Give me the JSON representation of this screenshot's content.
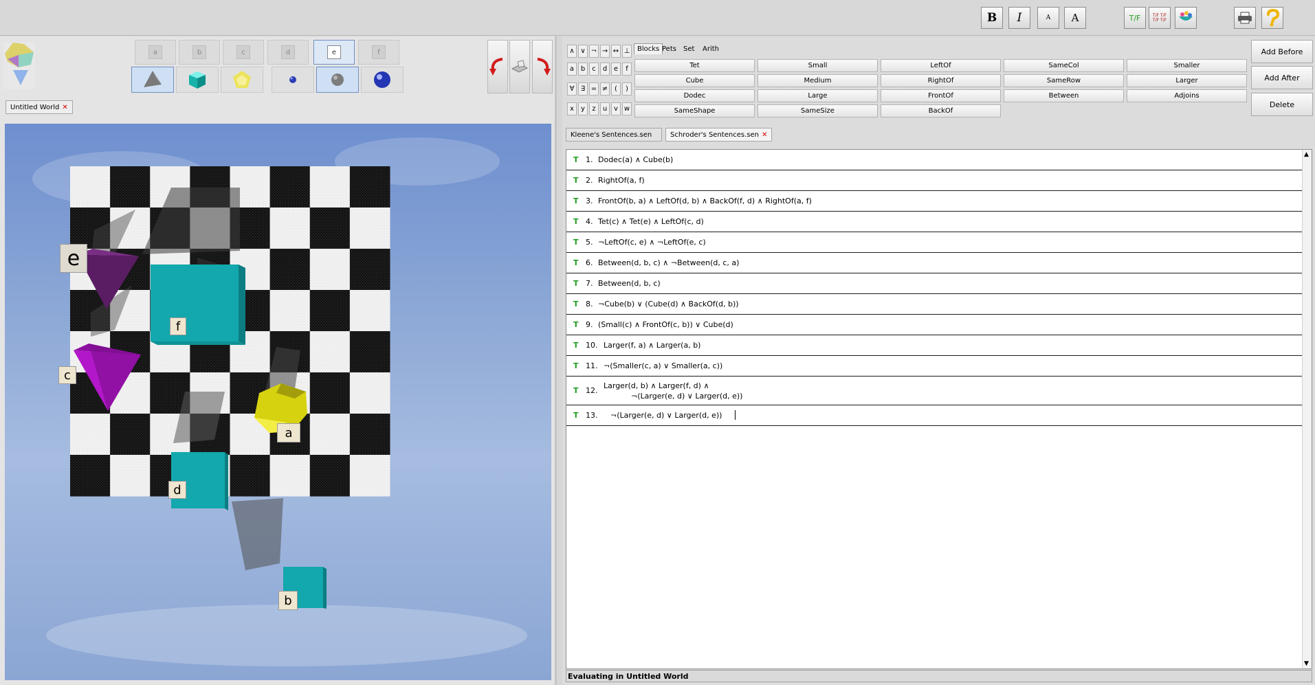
{
  "toolbar": {
    "bold_label": "B",
    "italic_label": "I",
    "font_smaller_label": "A",
    "font_larger_label": "A",
    "tf_label": "T/F",
    "tf_grid_label": "T/F T/F T/F T/F",
    "icons": [
      "bold-icon",
      "italic-icon",
      "font-smaller-icon",
      "font-larger-icon",
      "tf-icon",
      "truth-table-icon",
      "verify-icon",
      "print-icon",
      "help-icon"
    ]
  },
  "world_toolbar": {
    "labels": [
      "a",
      "b",
      "c",
      "d",
      "e",
      "f"
    ],
    "selected_label": "e",
    "shapes": [
      "tetrahedron",
      "cube",
      "dodecahedron"
    ],
    "sizes": [
      "small",
      "medium",
      "large"
    ],
    "selected_size": "medium"
  },
  "world_tab": {
    "label": "Untitled World"
  },
  "world": {
    "blocks": [
      {
        "name": "a",
        "shape": "Dodec",
        "size": "medium",
        "color": "#d7d20f"
      },
      {
        "name": "b",
        "shape": "Cube",
        "size": "small",
        "color": "#12a8ad"
      },
      {
        "name": "c",
        "shape": "Tet",
        "size": "medium",
        "color": "#b217c9"
      },
      {
        "name": "d",
        "shape": "Cube",
        "size": "medium",
        "color": "#12a8ad"
      },
      {
        "name": "e",
        "shape": "Tet",
        "size": "medium",
        "color": "#6b1f76"
      },
      {
        "name": "f",
        "shape": "Cube",
        "size": "large",
        "color": "#12a8ad"
      }
    ]
  },
  "symbols": {
    "row1": [
      "∧",
      "∨",
      "¬",
      "→",
      "↔",
      "⊥"
    ],
    "row2": [
      "a",
      "b",
      "c",
      "d",
      "e",
      "f"
    ],
    "row3": [
      "∀",
      "∃",
      "=",
      "≠",
      "(",
      ")"
    ],
    "row4": [
      "x",
      "y",
      "z",
      "u",
      "v",
      "w"
    ]
  },
  "predicate_tabs": [
    "Blocks",
    "Pets",
    "Set",
    "Arith"
  ],
  "predicate_tab_active": "Blocks",
  "predicates": [
    [
      "Tet",
      "Small",
      "LeftOf",
      "SameCol",
      "Smaller"
    ],
    [
      "Cube",
      "Medium",
      "RightOf",
      "SameRow",
      "Larger"
    ],
    [
      "Dodec",
      "Large",
      "FrontOf",
      "Between",
      "Adjoins"
    ],
    [
      "SameShape",
      "SameSize",
      "BackOf"
    ]
  ],
  "side_buttons": [
    "Add Before",
    "Add After",
    "Delete"
  ],
  "sentence_tabs": [
    {
      "label": "Kleene's Sentences.sen",
      "closable": false
    },
    {
      "label": "Schroder's Sentences.sen",
      "closable": true
    }
  ],
  "sentences": [
    {
      "tv": "T",
      "num": "1.",
      "text": "Dodec(a) ∧ Cube(b)"
    },
    {
      "tv": "T",
      "num": "2.",
      "text": "RightOf(a, f)"
    },
    {
      "tv": "T",
      "num": "3.",
      "text": "FrontOf(b, a) ∧ LeftOf(d, b) ∧ BackOf(f, d) ∧ RightOf(a, f)"
    },
    {
      "tv": "T",
      "num": "4.",
      "text": "Tet(c) ∧ Tet(e) ∧ LeftOf(c, d)"
    },
    {
      "tv": "T",
      "num": "5.",
      "text": "¬LeftOf(c, e) ∧ ¬LeftOf(e, c)"
    },
    {
      "tv": "T",
      "num": "6.",
      "text": "Between(d, b, c) ∧ ¬Between(d, c, a)"
    },
    {
      "tv": "T",
      "num": "7.",
      "text": "Between(d, b, c)"
    },
    {
      "tv": "T",
      "num": "8.",
      "text": "¬Cube(b) ∨ (Cube(d) ∧ BackOf(d, b))"
    },
    {
      "tv": "T",
      "num": "9.",
      "text": "(Small(c) ∧ FrontOf(c, b)) ∨ Cube(d)"
    },
    {
      "tv": "T",
      "num": "10.",
      "text": "Larger(f, a) ∧ Larger(a, b)"
    },
    {
      "tv": "T",
      "num": "11.",
      "text": "¬(Smaller(c, a) ∨ Smaller(a, c))"
    },
    {
      "tv": "T",
      "num": "12.",
      "text": "Larger(d, b) ∧ Larger(f, d) ∧",
      "text2": "¬(Larger(e, d) ∨ Larger(d, e))"
    },
    {
      "tv": "T",
      "num": "13.",
      "text": "¬(Larger(e, d) ∨ Larger(d, e))"
    }
  ],
  "status": "Evaluating in Untitled World"
}
